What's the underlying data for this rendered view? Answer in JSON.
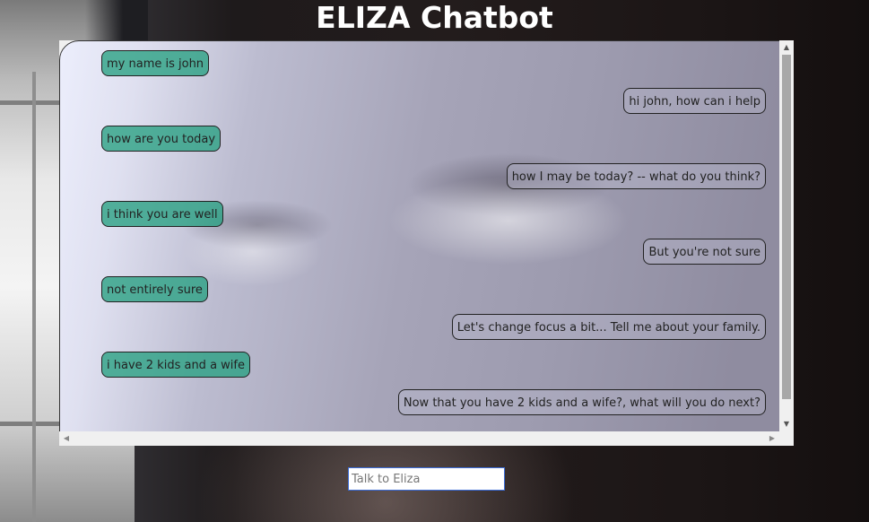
{
  "page": {
    "title": "ELIZA Chatbot"
  },
  "chat": {
    "messages": [
      {
        "from": "user",
        "text": "my name is john"
      },
      {
        "from": "bot",
        "text": "hi john, how can i help"
      },
      {
        "from": "user",
        "text": "how are you today"
      },
      {
        "from": "bot",
        "text": "how I may be today? -- what do you think?"
      },
      {
        "from": "user",
        "text": "i think you are well"
      },
      {
        "from": "bot",
        "text": "But you're not sure"
      },
      {
        "from": "user",
        "text": "not entirely sure"
      },
      {
        "from": "bot",
        "text": "Let's change focus a bit... Tell me about your family."
      },
      {
        "from": "user",
        "text": "i have 2 kids and a wife"
      },
      {
        "from": "bot",
        "text": "Now that you have 2 kids and a wife?, what will you do next?"
      }
    ]
  },
  "input": {
    "placeholder": "Talk to Eliza",
    "value": ""
  },
  "icons": {
    "scroll_up": "scroll-up-arrow-icon",
    "scroll_down": "scroll-down-arrow-icon",
    "scroll_left": "scroll-left-arrow-icon",
    "scroll_right": "scroll-right-arrow-icon"
  },
  "colors": {
    "user_bubble": "#2aa082",
    "title_text": "#ffffff",
    "input_border": "#3b6cd8"
  }
}
